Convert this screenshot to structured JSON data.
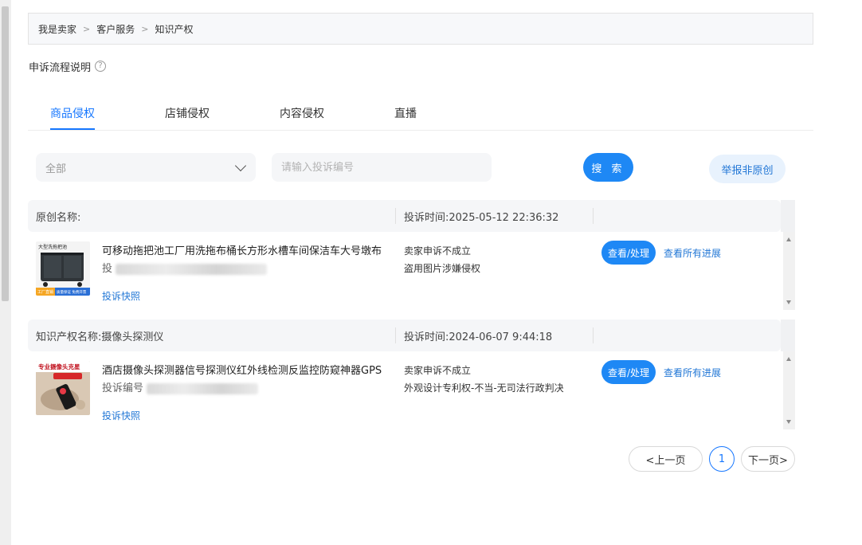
{
  "breadcrumb": {
    "items": [
      "我是卖家",
      "客户服务",
      "知识产权"
    ],
    "separator": ">"
  },
  "process_note": {
    "label": "申诉流程说明",
    "icon": "question-circle-icon"
  },
  "tabs": [
    {
      "label": "商品侵权",
      "active": true
    },
    {
      "label": "店铺侵权",
      "active": false
    },
    {
      "label": "内容侵权",
      "active": false
    },
    {
      "label": "直播",
      "active": false
    }
  ],
  "filter": {
    "selected": "全部",
    "icon": "chevron-down-icon"
  },
  "search": {
    "placeholder": "请输入投诉编号",
    "value": "",
    "button": "搜 索"
  },
  "report_button": "举报非原创",
  "complaints": [
    {
      "header_title": "原创名称:",
      "header_time": "投诉时间:2025-05-12 22:36:32",
      "product_title": "可移动拖把池工厂用洗拖布桶长方形水槽车间保洁车大号墩布",
      "complaint_no_prefix": "投",
      "snapshot": "投诉快照",
      "status": "卖家申诉不成立",
      "reason": "盗用图片涉嫌侵权",
      "handle_button": "查看/处理",
      "progress_link": "查看所有进展",
      "thumb_banner": "大型洗拖把池",
      "thumb_footer_a": "工厂直销",
      "thumb_footer_b": "质量保证 免费开票"
    },
    {
      "header_title": "知识产权名称:摄像头探测仪",
      "header_time": "投诉时间:2024-06-07 9:44:18",
      "product_title": "酒店摄像头探测器信号探测仪红外线检测反监控防窥神器GPS",
      "complaint_no_prefix": "投诉编号",
      "snapshot": "投诉快照",
      "status": "卖家申诉不成立",
      "reason": "外观设计专利权-不当-无司法行政判决",
      "handle_button": "查看/处理",
      "progress_link": "查看所有进展",
      "thumb_banner": "专业摄像头克星",
      "thumb_footer_a": "",
      "thumb_footer_b": ""
    }
  ],
  "pagination": {
    "prev": "<上一页",
    "current": "1",
    "next": "下一页>"
  },
  "colors": {
    "accent": "#1677ff",
    "button": "#1e88f5",
    "link": "#2277d6"
  }
}
